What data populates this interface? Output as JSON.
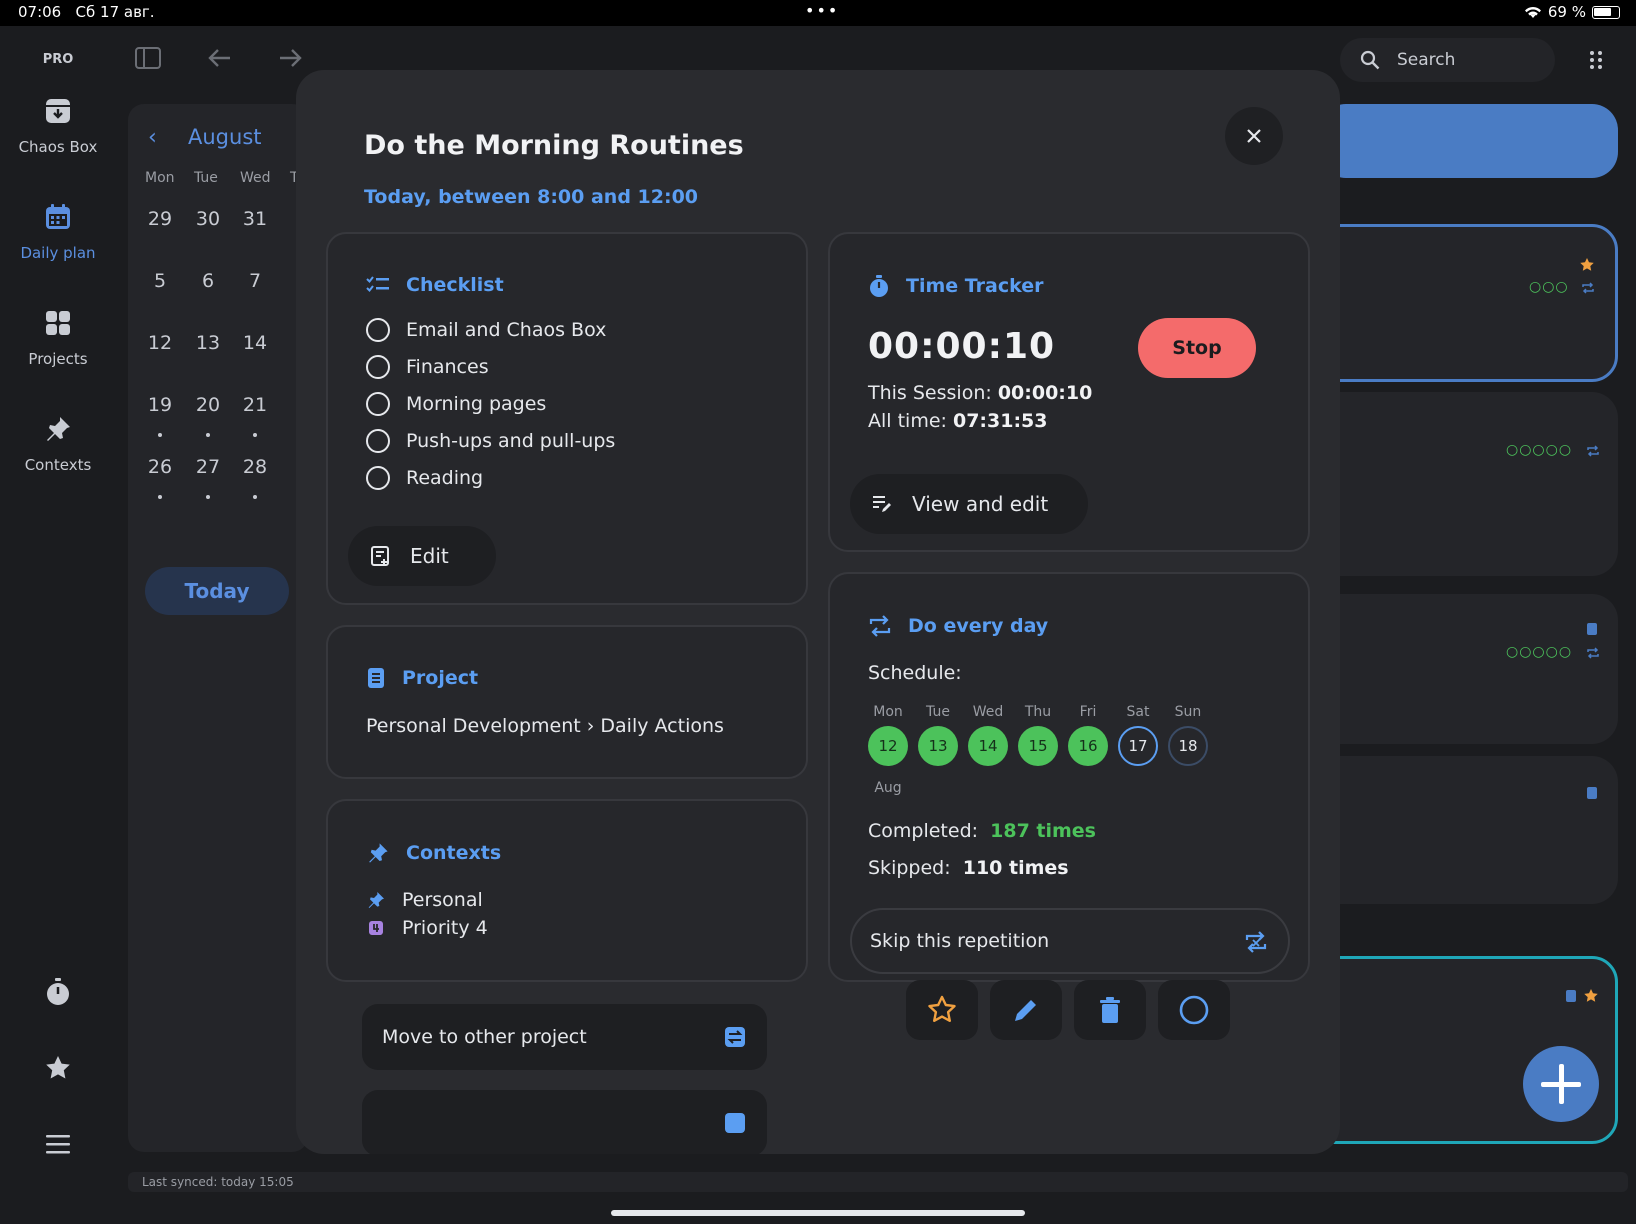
{
  "status_bar": {
    "time": "07:06",
    "date": "Сб 17 авг.",
    "battery": "69 %"
  },
  "sidebar": {
    "badge": "PRO",
    "items": [
      {
        "label": "Chaos Box"
      },
      {
        "label": "Daily plan"
      },
      {
        "label": "Projects"
      },
      {
        "label": "Contexts"
      }
    ]
  },
  "calendar": {
    "month": "August",
    "weekdays": [
      "Mon",
      "Tue",
      "Wed",
      "T"
    ],
    "rows": [
      [
        "29",
        "30",
        "31"
      ],
      [
        "5",
        "6",
        "7"
      ],
      [
        "12",
        "13",
        "14"
      ],
      [
        "19",
        "20",
        "21"
      ],
      [
        "26",
        "27",
        "28"
      ]
    ],
    "today_label": "Today"
  },
  "search": {
    "placeholder": "Search"
  },
  "sync": {
    "text": "Last synced: today 15:05"
  },
  "modal": {
    "title": "Do the Morning Routines",
    "subtitle": "Today, between 8:00 and 12:00",
    "checklist": {
      "title": "Checklist",
      "items": [
        "Email and Chaos Box",
        "Finances",
        "Morning pages",
        "Push-ups and pull-ups",
        "Reading"
      ],
      "edit_label": "Edit"
    },
    "project": {
      "title": "Project",
      "path": "Personal Development › Daily Actions"
    },
    "contexts": {
      "title": "Contexts",
      "items": [
        "Personal",
        "Priority 4"
      ]
    },
    "time_tracker": {
      "title": "Time Tracker",
      "elapsed": "00:00:10",
      "stop_label": "Stop",
      "session_label": "This Session:",
      "session_value": "00:00:10",
      "alltime_label": "All time:",
      "alltime_value": "07:31:53",
      "view_edit_label": "View and edit"
    },
    "repeat": {
      "title": "Do every day",
      "schedule_label": "Schedule:",
      "days": [
        {
          "dow": "Mon",
          "num": "12",
          "state": "done"
        },
        {
          "dow": "Tue",
          "num": "13",
          "state": "done"
        },
        {
          "dow": "Wed",
          "num": "14",
          "state": "done"
        },
        {
          "dow": "Thu",
          "num": "15",
          "state": "done"
        },
        {
          "dow": "Fri",
          "num": "16",
          "state": "done"
        },
        {
          "dow": "Sat",
          "num": "17",
          "state": "today"
        },
        {
          "dow": "Sun",
          "num": "18",
          "state": "future"
        }
      ],
      "month_label": "Aug",
      "completed_label": "Completed:",
      "completed_value": "187 times",
      "skipped_label": "Skipped:",
      "skipped_value": "110 times",
      "skip_label": "Skip this repetition"
    },
    "move_label": "Move to other project"
  },
  "colors": {
    "accent": "#5b9ef2",
    "done": "#4cc25b",
    "stop": "#f46b6b",
    "star": "#f0a040"
  }
}
